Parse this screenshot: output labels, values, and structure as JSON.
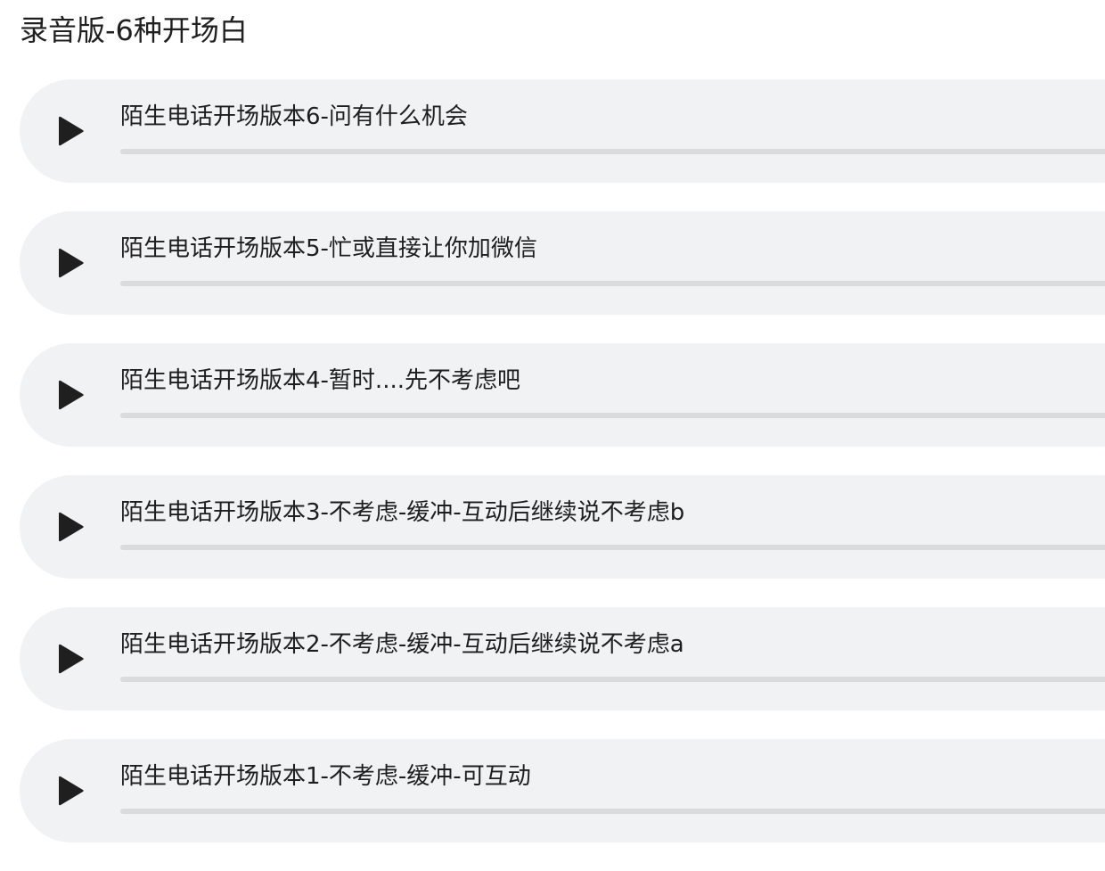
{
  "page": {
    "title": "录音版-6种开场白"
  },
  "colors": {
    "card_background": "#f1f2f4",
    "progress_track": "#dadbdd",
    "play_icon": "#1f1f1f"
  },
  "tracks": [
    {
      "title": "陌生电话开场版本6-问有什么机会",
      "progress": 0,
      "icon": "play-icon"
    },
    {
      "title": "陌生电话开场版本5-忙或直接让你加微信",
      "progress": 0,
      "icon": "play-icon"
    },
    {
      "title": "陌生电话开场版本4-暂时....先不考虑吧",
      "progress": 0,
      "icon": "play-icon"
    },
    {
      "title": "陌生电话开场版本3-不考虑-缓冲-互动后继续说不考虑b",
      "progress": 0,
      "icon": "play-icon"
    },
    {
      "title": "陌生电话开场版本2-不考虑-缓冲-互动后继续说不考虑a",
      "progress": 0,
      "icon": "play-icon"
    },
    {
      "title": "陌生电话开场版本1-不考虑-缓冲-可互动",
      "progress": 0,
      "icon": "play-icon"
    }
  ]
}
